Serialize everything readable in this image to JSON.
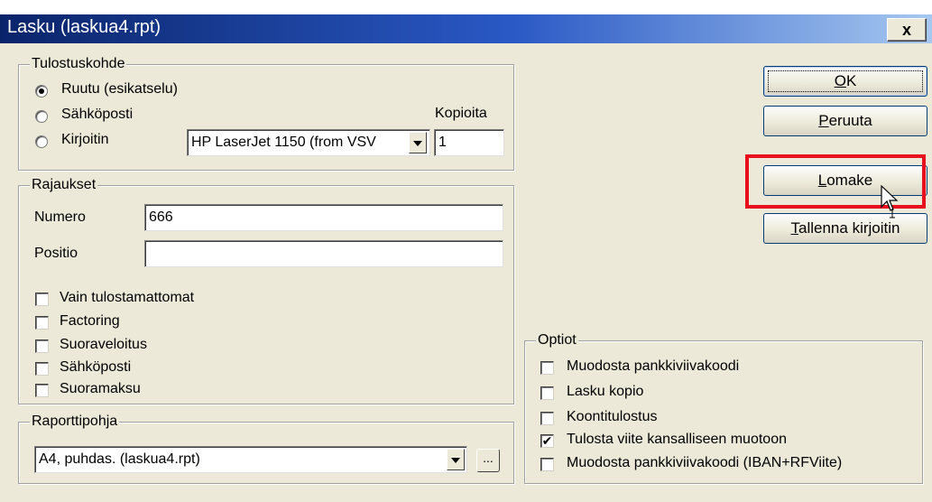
{
  "window": {
    "title": "Lasku (laskua4.rpt)",
    "close_label": "x"
  },
  "tulostuskohde": {
    "legend": "Tulostuskohde",
    "options": [
      {
        "label": "Ruutu (esikatselu)",
        "checked": true
      },
      {
        "label": "Sähköposti",
        "checked": false
      },
      {
        "label": "Kirjoitin",
        "checked": false
      }
    ],
    "printer_value": "HP LaserJet 1150 (from VSV",
    "copies_label": "Kopioita",
    "copies_value": "1"
  },
  "rajaukset": {
    "legend": "Rajaukset",
    "numero_label": "Numero",
    "numero_value": "666",
    "positio_label": "Positio",
    "positio_value": "",
    "checks": [
      {
        "label": "Vain tulostamattomat",
        "checked": false
      },
      {
        "label": "Factoring",
        "checked": false
      },
      {
        "label": "Suoraveloitus",
        "checked": false
      },
      {
        "label": "Sähköposti",
        "checked": false
      },
      {
        "label": "Suoramaksu",
        "checked": false
      }
    ]
  },
  "raporttipohja": {
    "legend": "Raporttipohja",
    "value": "A4, puhdas. (laskua4.rpt)",
    "browse_label": "..."
  },
  "optiot": {
    "legend": "Optiot",
    "checks": [
      {
        "label": "Muodosta pankkiviivakoodi",
        "checked": false
      },
      {
        "label": "Lasku kopio",
        "checked": false
      },
      {
        "label": "Koontitulostus",
        "checked": false
      },
      {
        "label": "Tulosta viite kansalliseen muotoon",
        "checked": true
      },
      {
        "label": "Muodosta pankkiviivakoodi (IBAN+RFViite)",
        "checked": false
      }
    ]
  },
  "buttons": {
    "ok": {
      "accel": "O",
      "rest": "K"
    },
    "peruuta": {
      "accel": "P",
      "rest": "eruuta"
    },
    "lomake": {
      "accel": "L",
      "rest": "omake"
    },
    "tallenna": {
      "accel": "T",
      "rest": "allenna kirjoitin"
    }
  },
  "check_mark": "✔",
  "colors": {
    "highlight": "#e8101c",
    "title_start": "#0a246a",
    "title_end": "#a6c8f0"
  }
}
